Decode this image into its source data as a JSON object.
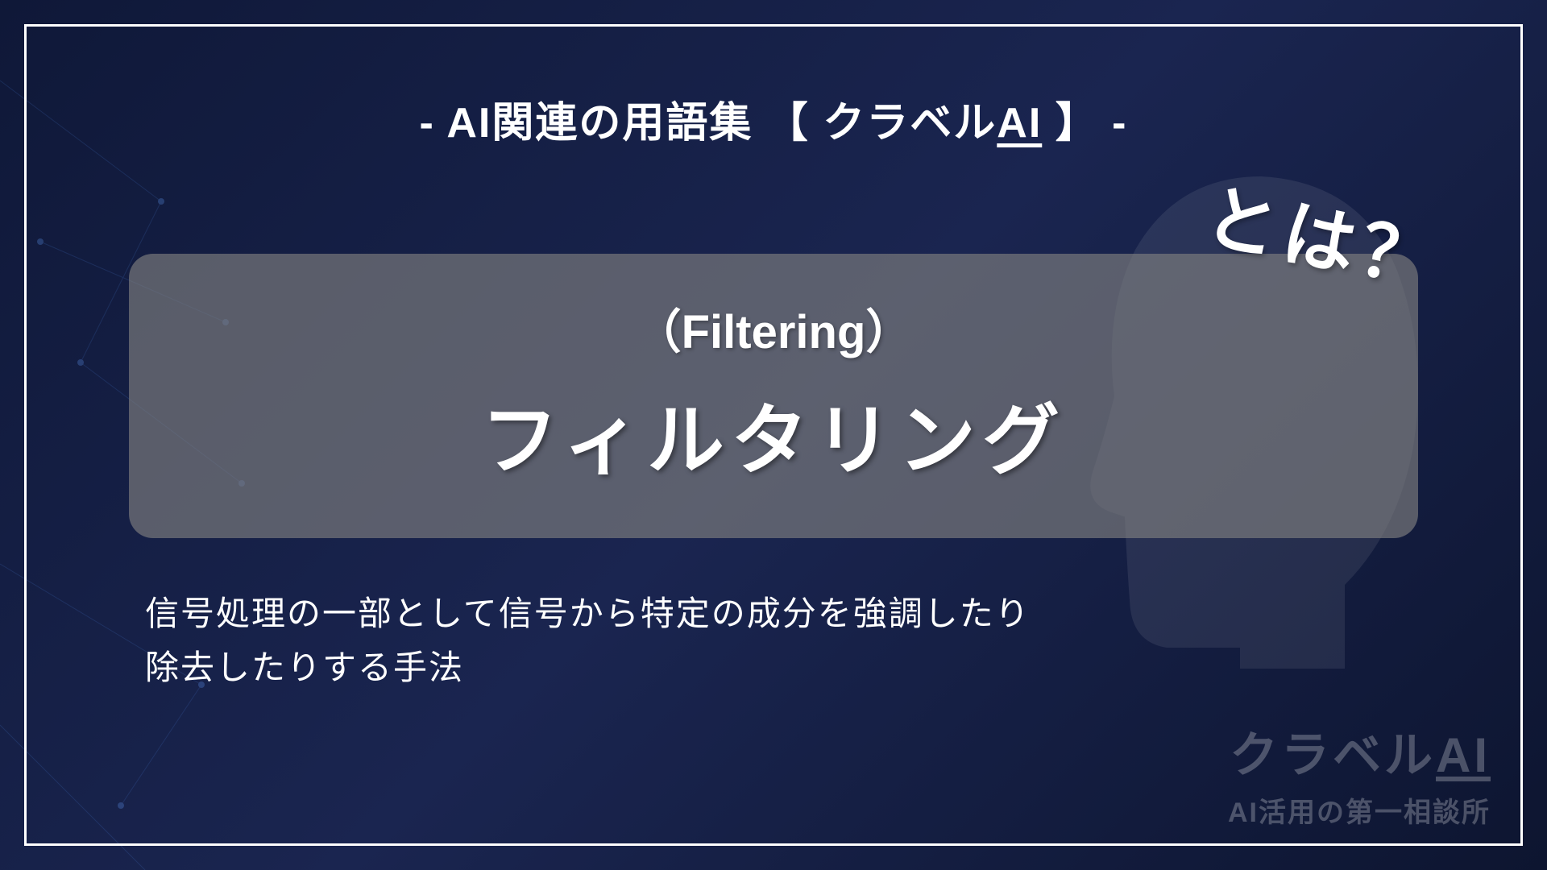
{
  "header": {
    "prefix": "- ",
    "text": "AI関連の用語集 【 クラベル",
    "ai_text": "AI",
    "suffix": " 】 -"
  },
  "term": {
    "english": "（Filtering）",
    "japanese": "フィルタリング",
    "towa": "とは？"
  },
  "description": {
    "line1": "信号処理の一部として信号から特定の成分を強調したり",
    "line2": "除去したりする手法"
  },
  "watermark": {
    "title_prefix": "クラベル",
    "title_ai": "AI",
    "subtitle": "AI活用の第一相談所"
  }
}
